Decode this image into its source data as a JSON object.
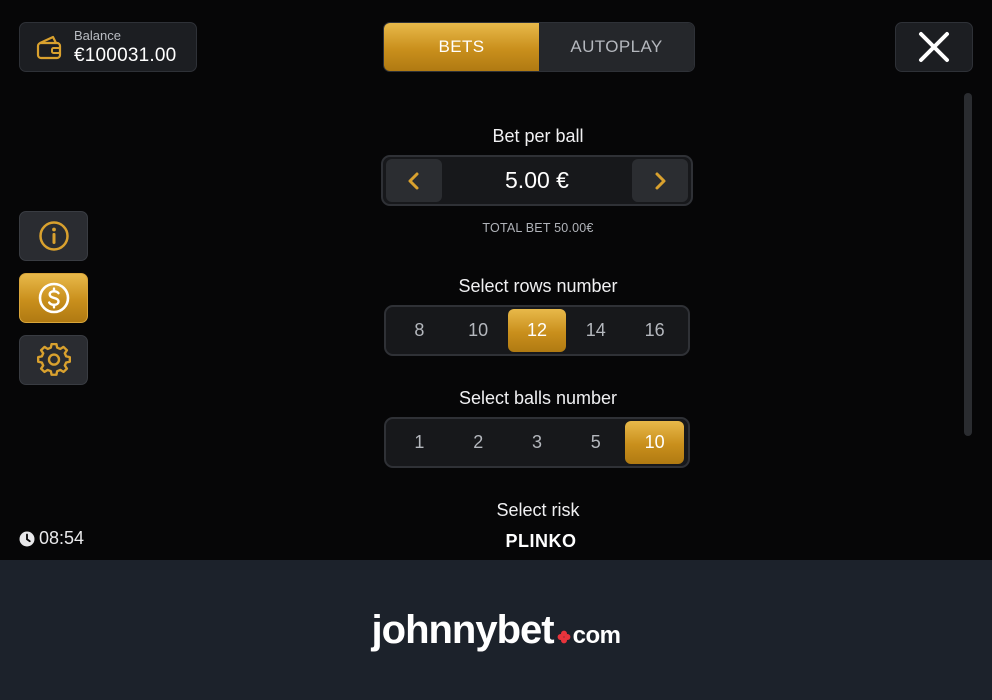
{
  "balance": {
    "label": "Balance",
    "value": "€100031.00"
  },
  "tabs": [
    {
      "label": "BETS",
      "active": true
    },
    {
      "label": "AUTOPLAY",
      "active": false
    }
  ],
  "sidebar": [
    {
      "icon": "info-icon",
      "active": false
    },
    {
      "icon": "dollar-coin-icon",
      "active": true
    },
    {
      "icon": "gear-icon",
      "active": false
    }
  ],
  "bet": {
    "label": "Bet per ball",
    "value": "5.00 €",
    "total": "TOTAL BET 50.00€",
    "decrease_icon": "chevron-left-icon",
    "increase_icon": "chevron-right-icon"
  },
  "rows": {
    "label": "Select rows number",
    "options": [
      "8",
      "10",
      "12",
      "14",
      "16"
    ],
    "selected": "12"
  },
  "balls": {
    "label": "Select balls number",
    "options": [
      "1",
      "2",
      "3",
      "5",
      "10"
    ],
    "selected": "10"
  },
  "risk": {
    "label": "Select risk"
  },
  "game": {
    "name": "PLINKO"
  },
  "clock": {
    "time": "08:54"
  },
  "brand": {
    "main": "johnnybet",
    "tld": "com"
  },
  "colors": {
    "accent": "#d9a12e",
    "accent_dark": "#b07a12",
    "panel": "#1c1e22",
    "background": "#060607",
    "brand_bar": "#1c222b",
    "brand_red": "#e8343c"
  }
}
